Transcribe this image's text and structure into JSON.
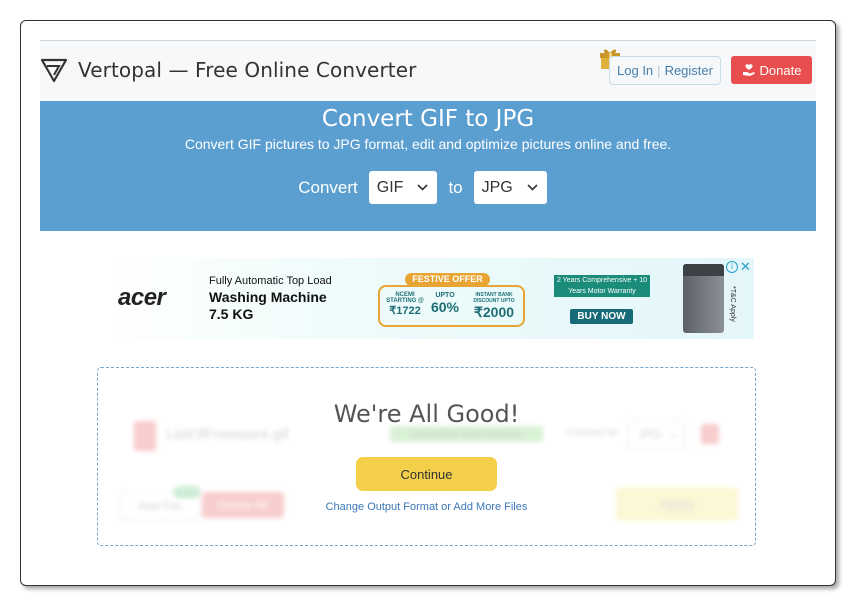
{
  "header": {
    "brand": "Vertopal — Free Online Converter",
    "login": "Log In",
    "register": "Register",
    "donate": "Donate",
    "icons": {
      "logo": "vertopal-logo-icon",
      "gift": "gift-icon",
      "donate": "hand-heart-icon"
    }
  },
  "hero": {
    "title": "Convert GIF to JPG",
    "subtitle": "Convert GIF pictures to JPG format, edit and optimize pictures online and free.",
    "convert_label": "Convert",
    "from_value": "GIF",
    "to_label": "to",
    "to_value": "JPG"
  },
  "ad": {
    "brand": "acer",
    "line1": "Fully Automatic Top Load",
    "line2": "Washing Machine",
    "line3": "7.5 KG",
    "festive": "FESTIVE OFFER",
    "offers": [
      {
        "small": "NCEMI STARTING @",
        "big": "₹1722"
      },
      {
        "small": "UPTO",
        "big": "60%"
      },
      {
        "small": "INSTANT BANK DISCOUNT UPTO",
        "big": "₹2000"
      }
    ],
    "warranty": "2 Years Comprehensive + 10 Years Motor Warranty",
    "cta": "BUY NOW",
    "tc": "*T&C Apply"
  },
  "dropzone": {
    "title": "We're All Good!",
    "continue": "Continue",
    "change_link": "Change Output Format or Add More Files",
    "ghost": {
      "file_name": "ListOfFreeware.gif",
      "status": "Uploaded Successfully",
      "convert_to": "Convert to",
      "format": "JPG",
      "add_file": "Add File",
      "new_badge": "NEW",
      "delete_all": "Delete All",
      "apply": "Apply"
    }
  },
  "colors": {
    "hero_bg": "#5b9ed0",
    "donate_bg": "#e84e4e",
    "continue_bg": "#f3cf4a",
    "link": "#3b78b8"
  }
}
